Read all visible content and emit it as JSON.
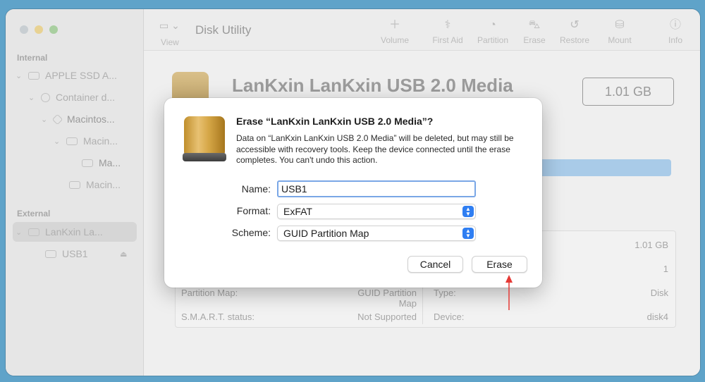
{
  "app": {
    "title": "Disk Utility",
    "view_label": "View"
  },
  "toolbar": {
    "tools": [
      {
        "label": "Volume",
        "icon": "plus-icon"
      },
      {
        "label": "First Aid",
        "icon": "stethoscope-icon"
      },
      {
        "label": "Partition",
        "icon": "pie-icon"
      },
      {
        "label": "Erase",
        "icon": "car-icon"
      },
      {
        "label": "Restore",
        "icon": "restore-icon"
      },
      {
        "label": "Mount",
        "icon": "mount-icon"
      },
      {
        "label": "Info",
        "icon": "info-icon"
      }
    ]
  },
  "sidebar": {
    "internal_header": "Internal",
    "external_header": "External",
    "items": [
      {
        "label": "APPLE SSD A..."
      },
      {
        "label": "Container d..."
      },
      {
        "label": "Macintos..."
      },
      {
        "label": "Macin..."
      },
      {
        "label": "Ma..."
      },
      {
        "label": "Macin..."
      }
    ],
    "external_items": [
      {
        "label": "LanKxin La..."
      },
      {
        "label": "USB1"
      }
    ]
  },
  "main": {
    "drive_title": "LanKxin LanKxin USB 2.0 Media",
    "size": "1.01 GB",
    "info": {
      "right_values": [
        "1.01 GB",
        "1"
      ],
      "partition_map_label": "Partition Map:",
      "partition_map_value": "GUID Partition Map",
      "type_label": "Type:",
      "type_value": "Disk",
      "smart_label": "S.M.A.R.T. status:",
      "smart_value": "Not Supported",
      "device_label": "Device:",
      "device_value": "disk4"
    }
  },
  "dialog": {
    "title": "Erase “LanKxin LanKxin USB 2.0 Media”?",
    "message": "Data on “LanKxin LanKxin USB 2.0 Media” will be deleted, but may still be accessible with recovery tools. Keep the device connected until the erase completes. You can't undo this action.",
    "name_label": "Name:",
    "name_value": "USB1",
    "format_label": "Format:",
    "format_value": "ExFAT",
    "scheme_label": "Scheme:",
    "scheme_value": "GUID Partition Map",
    "cancel_label": "Cancel",
    "erase_label": "Erase"
  },
  "colors": {
    "accent": "#2f7ef2",
    "annotation_arrow": "#e53935"
  }
}
